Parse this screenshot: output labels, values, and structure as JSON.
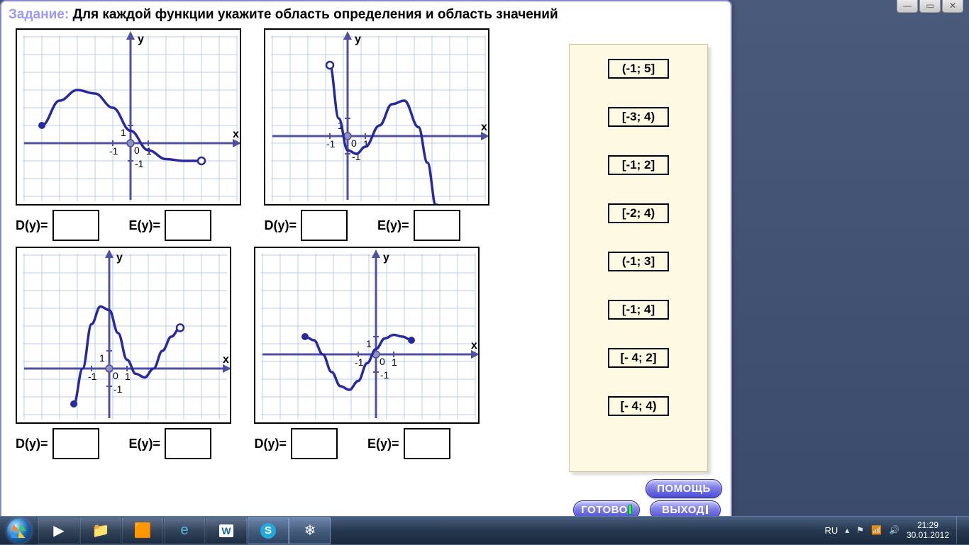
{
  "title_prefix": "Задание:",
  "title_text": "Для каждой функции укажите область определения и область значений",
  "axis": {
    "x": "x",
    "y": "y",
    "neg1": "-1",
    "one": "1",
    "zero": "0"
  },
  "labels": {
    "D": "D(y)=",
    "E": "E(y)="
  },
  "chips": [
    "(-1; 5]",
    "[-3; 4)",
    "[-1; 2]",
    "[-2; 4)",
    "(-1; 3]",
    "[-1; 4]",
    "[- 4; 2]",
    "[- 4; 4)"
  ],
  "buttons": {
    "help": "ПОМОЩЬ",
    "ready": "ГОТОВО",
    "exit": "ВЫХОД"
  },
  "taskbar": {
    "lang": "RU",
    "time": "21:29",
    "date": "30.01.2012"
  },
  "chart_data": [
    {
      "type": "line",
      "title": "",
      "xlabel": "x",
      "ylabel": "y",
      "xlim": [
        -6,
        6
      ],
      "ylim": [
        -5,
        5
      ],
      "series": [
        {
          "name": "f1",
          "points": [
            [
              -5,
              1
            ],
            [
              -4,
              2.4
            ],
            [
              -3,
              3
            ],
            [
              -2,
              2.8
            ],
            [
              -1,
              2
            ],
            [
              0,
              0.7
            ],
            [
              1,
              -0.4
            ],
            [
              2,
              -0.9
            ],
            [
              3,
              -1
            ],
            [
              4,
              -1
            ]
          ],
          "endpoints": {
            "left": "closed",
            "right": "open"
          }
        }
      ]
    },
    {
      "type": "line",
      "title": "",
      "xlabel": "x",
      "ylabel": "y",
      "xlim": [
        -6,
        6
      ],
      "ylim": [
        -5,
        5
      ],
      "series": [
        {
          "name": "f2",
          "points": [
            [
              -1,
              4
            ],
            [
              -0.5,
              1
            ],
            [
              0,
              -0.8
            ],
            [
              0.5,
              -1
            ],
            [
              1,
              -0.6
            ],
            [
              1.8,
              0.6
            ],
            [
              2.5,
              1.8
            ],
            [
              3.2,
              2
            ],
            [
              4,
              0.5
            ],
            [
              4.5,
              -1.5
            ],
            [
              5,
              -4
            ]
          ],
          "endpoints": {
            "left": "open",
            "right": "closed"
          }
        }
      ]
    },
    {
      "type": "line",
      "title": "",
      "xlabel": "x",
      "ylabel": "y",
      "xlim": [
        -6,
        6
      ],
      "ylim": [
        -5,
        5
      ],
      "series": [
        {
          "name": "f3",
          "points": [
            [
              -2,
              -2
            ],
            [
              -1.5,
              0
            ],
            [
              -1,
              2.5
            ],
            [
              -0.5,
              3.5
            ],
            [
              0,
              3.3
            ],
            [
              0.5,
              2
            ],
            [
              1,
              0.5
            ],
            [
              1.5,
              -0.3
            ],
            [
              2,
              -0.5
            ],
            [
              2.5,
              0
            ],
            [
              3,
              1
            ],
            [
              3.5,
              1.8
            ],
            [
              4,
              2.3
            ]
          ],
          "endpoints": {
            "left": "closed",
            "right": "open"
          }
        }
      ]
    },
    {
      "type": "line",
      "title": "",
      "xlabel": "x",
      "ylabel": "y",
      "xlim": [
        -6,
        6
      ],
      "ylim": [
        -5,
        5
      ],
      "series": [
        {
          "name": "f4",
          "points": [
            [
              -4,
              1
            ],
            [
              -3.5,
              0.8
            ],
            [
              -3,
              0
            ],
            [
              -2.5,
              -1
            ],
            [
              -2,
              -1.8
            ],
            [
              -1.5,
              -2
            ],
            [
              -1,
              -1.5
            ],
            [
              -0.5,
              -0.5
            ],
            [
              0,
              0.3
            ],
            [
              0.5,
              0.9
            ],
            [
              1,
              1.1
            ],
            [
              1.5,
              1
            ],
            [
              2,
              0.8
            ]
          ],
          "endpoints": {
            "left": "closed",
            "right": "closed"
          }
        }
      ]
    }
  ]
}
